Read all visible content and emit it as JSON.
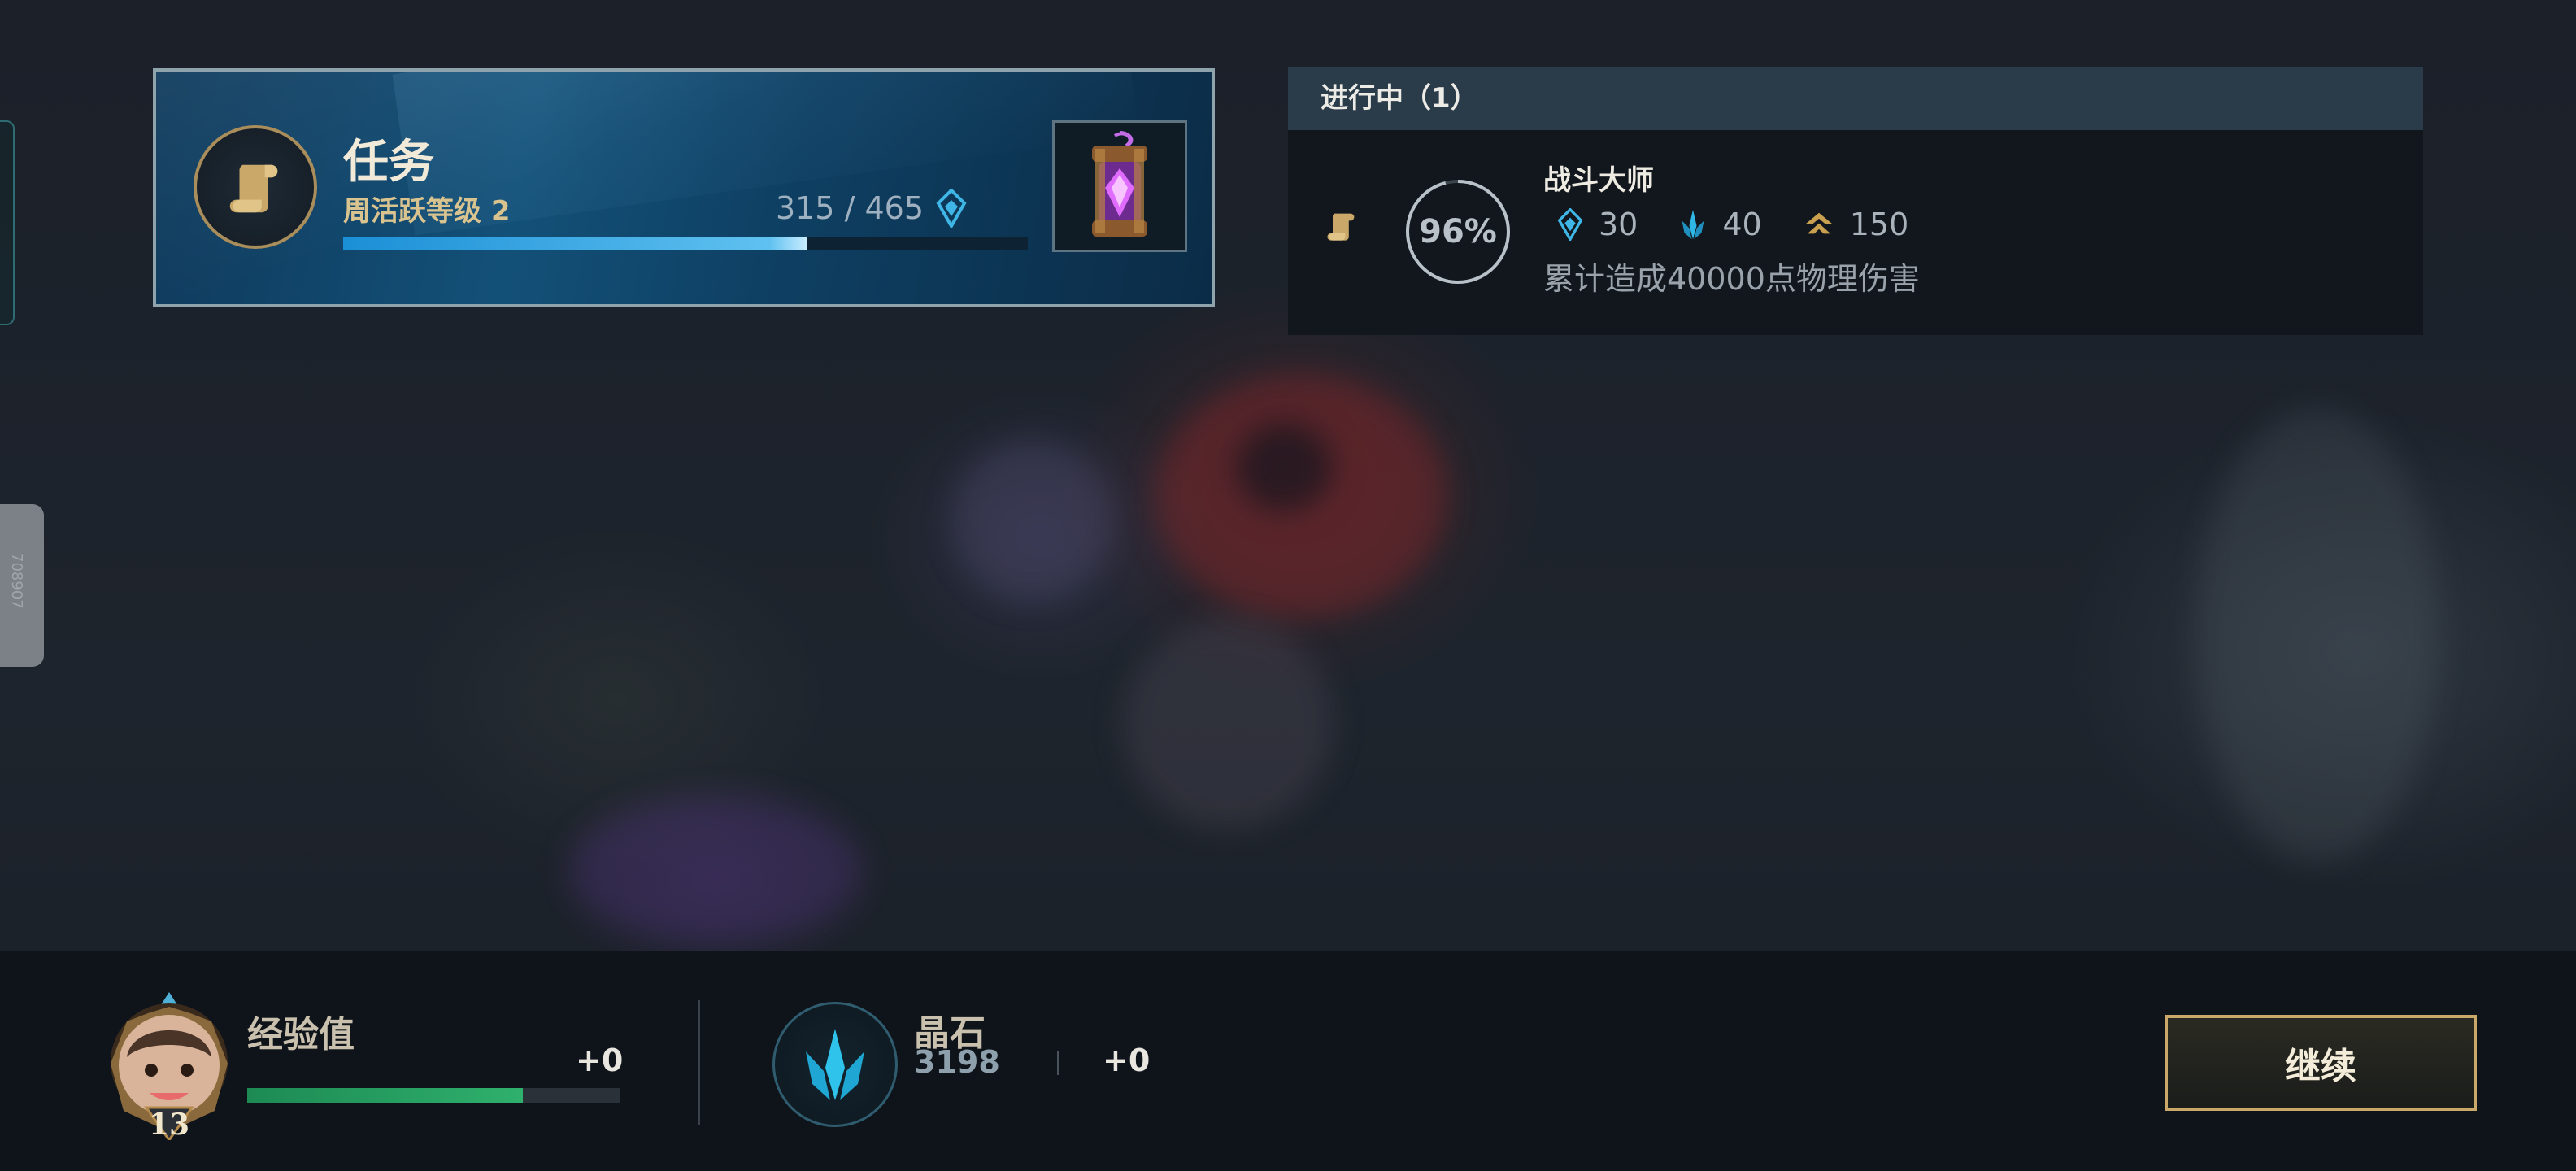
{
  "mission": {
    "title": "任务",
    "subtitle": "周活跃等级 2",
    "progress_current": "315",
    "progress_sep": "/",
    "progress_total": "465",
    "progress_fraction": 0.677,
    "emblem_icon": "scroll-icon",
    "progress_icon": "activity-gem-icon",
    "reward_icon": "purple-capsule-chest-icon"
  },
  "in_progress": {
    "header": "进行中（1）",
    "quest": {
      "name": "战斗大师",
      "percent_label": "96%",
      "percent": 0.96,
      "icon": "scroll-icon",
      "description": "累计造成40000点物理伤害",
      "rewards": [
        {
          "icon": "activity-gem-icon",
          "value": "30"
        },
        {
          "icon": "blue-essence-icon",
          "value": "40"
        },
        {
          "icon": "xp-chevron-icon",
          "value": "150"
        }
      ]
    }
  },
  "summary": {
    "xp": {
      "label": "经验值",
      "gain": "+0",
      "level": "13",
      "progress_fraction": 0.74,
      "avatar_icon": "player-avatar-icon"
    },
    "gemstone": {
      "label": "晶石",
      "value": "3198",
      "gain": "+0",
      "icon": "crystal-icon"
    },
    "continue_label": "继续"
  },
  "side": {
    "tab_text": "708907"
  },
  "colors": {
    "accent_gold": "#c9a86a",
    "accent_blue": "#3fb6e6",
    "xp_green": "#2fb06c",
    "panel_header": "#2a3b4a"
  }
}
